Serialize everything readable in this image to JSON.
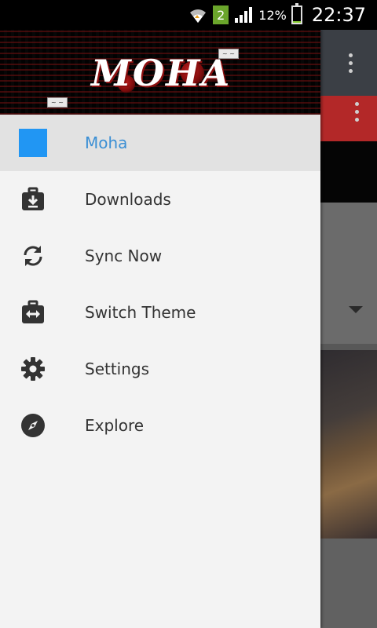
{
  "status_bar": {
    "notification_badge": "2",
    "battery_percent": "12%",
    "battery_level": 0.12,
    "time": "22:37",
    "icons": [
      "wifi-icon",
      "signal-icon",
      "battery-icon"
    ]
  },
  "drawer": {
    "header": {
      "logo_text": "MOHA",
      "brand_colors": {
        "background": "#070707",
        "accent": "#b01515"
      }
    },
    "items": [
      {
        "label": "Moha",
        "icon": "blue-square-icon",
        "active": true
      },
      {
        "label": "Downloads",
        "icon": "download-briefcase-icon",
        "active": false
      },
      {
        "label": "Sync Now",
        "icon": "sync-icon",
        "active": false
      },
      {
        "label": "Switch Theme",
        "icon": "switch-theme-icon",
        "active": false
      },
      {
        "label": "Settings",
        "icon": "gear-icon",
        "active": false
      },
      {
        "label": "Explore",
        "icon": "compass-icon",
        "active": false
      }
    ],
    "colors": {
      "active_text": "#3b8fd4",
      "active_bg": "#e2e2e2",
      "text": "#333333",
      "drawer_bg": "#f3f3f3"
    }
  }
}
